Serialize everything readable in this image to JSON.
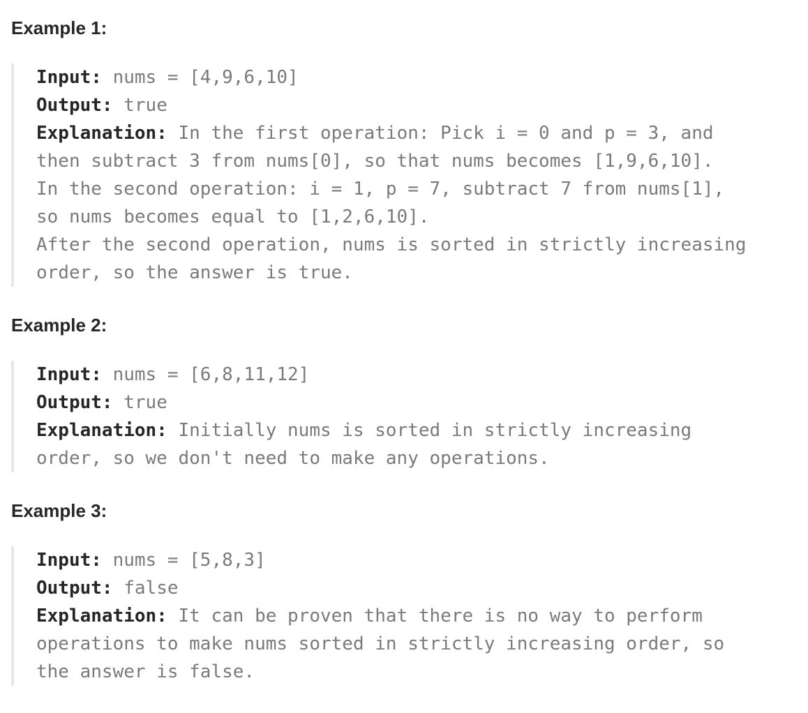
{
  "examples": [
    {
      "title": "Example 1:",
      "input_label": "Input:",
      "input_value": " nums = [4,9,6,10]",
      "output_label": "Output:",
      "output_value": " true",
      "explanation_label": "Explanation:",
      "explanation_first": " In the first operation: Pick i = 0 and p = 3, and",
      "explanation_rest": [
        "then subtract 3 from nums[0], so that nums becomes [1,9,6,10].",
        "In the second operation: i = 1, p = 7, subtract 7 from nums[1],",
        "so nums becomes equal to [1,2,6,10].",
        "After the second operation, nums is sorted in strictly increasing",
        "order, so the answer is true."
      ]
    },
    {
      "title": "Example 2:",
      "input_label": "Input:",
      "input_value": " nums = [6,8,11,12]",
      "output_label": "Output:",
      "output_value": " true",
      "explanation_label": "Explanation:",
      "explanation_first": " Initially nums is sorted in strictly increasing",
      "explanation_rest": [
        "order, so we don't need to make any operations."
      ]
    },
    {
      "title": "Example 3:",
      "input_label": "Input:",
      "input_value": " nums = [5,8,3]",
      "output_label": "Output:",
      "output_value": " false",
      "explanation_label": "Explanation:",
      "explanation_first": " It can be proven that there is no way to perform",
      "explanation_rest": [
        "operations to make nums sorted in strictly increasing order, so",
        "the answer is false."
      ]
    }
  ]
}
